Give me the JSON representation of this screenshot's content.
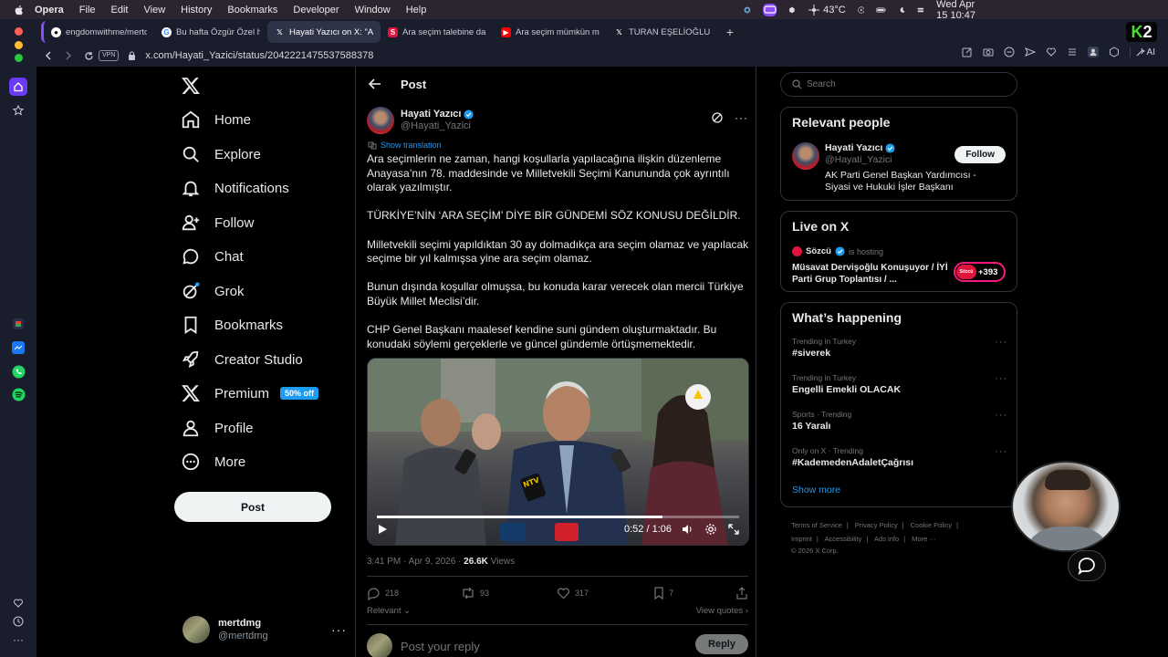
{
  "menubar": {
    "app": "Opera",
    "items": [
      "File",
      "Edit",
      "View",
      "History",
      "Bookmarks",
      "Developer",
      "Window",
      "Help"
    ],
    "temperature": "43°C",
    "datetime": "Wed Apr 15  10:47"
  },
  "tabs": [
    {
      "title": "engdomwithme/mertdmg",
      "favicon": "github-icon"
    },
    {
      "title": "Bu hafta Özgür Özel her",
      "favicon": "google-icon"
    },
    {
      "title": "Hayati Yazıcı on X: \"Ara",
      "favicon": "x-icon",
      "active": true
    },
    {
      "title": "Ara seçim talebine dair",
      "favicon": "sozcu-icon"
    },
    {
      "title": "Ara seçim mümkün mü?",
      "favicon": "youtube-icon"
    },
    {
      "title": "TURAN EŞELİOĞLU",
      "favicon": "x-icon"
    }
  ],
  "k2_label": "2",
  "address": {
    "vpn": "VPN",
    "url": "x.com/Hayati_Yazici/status/2042221475537588378",
    "ai_label": "AI"
  },
  "nav": {
    "items": [
      {
        "label": "Home",
        "icon": "home-icon"
      },
      {
        "label": "Explore",
        "icon": "search-icon"
      },
      {
        "label": "Notifications",
        "icon": "bell-icon"
      },
      {
        "label": "Follow",
        "icon": "person-add-icon"
      },
      {
        "label": "Chat",
        "icon": "chat-icon"
      },
      {
        "label": "Grok",
        "icon": "grok-icon"
      },
      {
        "label": "Bookmarks",
        "icon": "bookmark-icon"
      },
      {
        "label": "Creator Studio",
        "icon": "rocket-icon"
      },
      {
        "label": "Premium",
        "icon": "x-icon",
        "badge": "50% off"
      },
      {
        "label": "Profile",
        "icon": "person-icon"
      },
      {
        "label": "More",
        "icon": "more-circle-icon"
      }
    ],
    "post_button": "Post"
  },
  "account": {
    "name": "mertdmg",
    "handle": "@mertdmg"
  },
  "post": {
    "header": "Post",
    "author_name": "Hayati Yazıcı",
    "author_handle": "@Hayati_Yazici",
    "show_translation": "Show translation",
    "paragraphs": [
      "Ara seçimlerin ne zaman, hangi koşullarla yapılacağına ilişkin düzenleme Anayasa’nın 78. maddesinde ve Milletvekili Seçimi Kanununda çok ayrıntılı olarak yazılmıştır.",
      "TÜRKİYE’NİN ‘ARA SEÇİM’ DİYE BİR GÜNDEMİ SÖZ KONUSU DEĞİLDİR.",
      "Milletvekili seçimi yapıldıktan 30 ay dolmadıkça ara seçim olamaz ve yapılacak seçime bir yıl kalmışsa yine ara seçim olamaz.",
      "Bunun dışında koşullar olmuşsa, bu konuda karar verecek olan mercii Türkiye Büyük Millet Meclisi’dir.",
      "CHP Genel Başkanı maalesef kendine suni gündem oluşturmaktadır. Bu konudaki söylemi gerçeklerle ve güncel gündemle örtüşmemektedir."
    ],
    "video": {
      "time": "0:52 / 1:06",
      "progress": 0.788
    },
    "timestamp": "3:41 PM · Apr 9, 2026 · ",
    "views_count": "26.6K",
    "views_label": "Views",
    "replies": "218",
    "reposts": "93",
    "likes": "317",
    "bookmarks": "7",
    "relevant": "Relevant",
    "view_quotes": "View quotes",
    "reply_placeholder": "Post your reply",
    "reply_button": "Reply"
  },
  "right": {
    "search_placeholder": "Search",
    "relevant_people": {
      "title": "Relevant people",
      "name": "Hayati Yazıcı",
      "handle": "@Hayati_Yazici",
      "bio": "AK Parti Genel Başkan Yardımcısı - Siyasi ve Hukuki İşler Başkanı",
      "follow": "Follow"
    },
    "live": {
      "title": "Live on X",
      "source": "Sözcü",
      "hosting": "is hosting",
      "stream_title": "Müsavat Dervişoğlu Konuşuyor / İYİ Parti Grup Toplantısı / ...",
      "listeners": "+393",
      "badge_text": "Sözcü"
    },
    "happening": {
      "title": "What’s happening",
      "trends": [
        {
          "context": "Trending in Turkey",
          "name": "#siverek"
        },
        {
          "context": "Trending in Turkey",
          "name": "Engelli Emekli OLACAK"
        },
        {
          "context": "Sports · Trending",
          "name": "16 Yaralı"
        },
        {
          "context": "Only on X · Trending",
          "name": "#KademedenAdaletÇağrısı"
        }
      ],
      "show_more": "Show more"
    },
    "footer": {
      "links": [
        "Terms of Service",
        "Privacy Policy",
        "Cookie Policy",
        "Imprint",
        "Accessibility",
        "Ads info",
        "More ···"
      ],
      "copyright": "© 2026 X Corp."
    }
  },
  "colors": {
    "accent": "#1d9bf0",
    "live": "#f91880",
    "opera_purple": "#8b4dfc"
  }
}
